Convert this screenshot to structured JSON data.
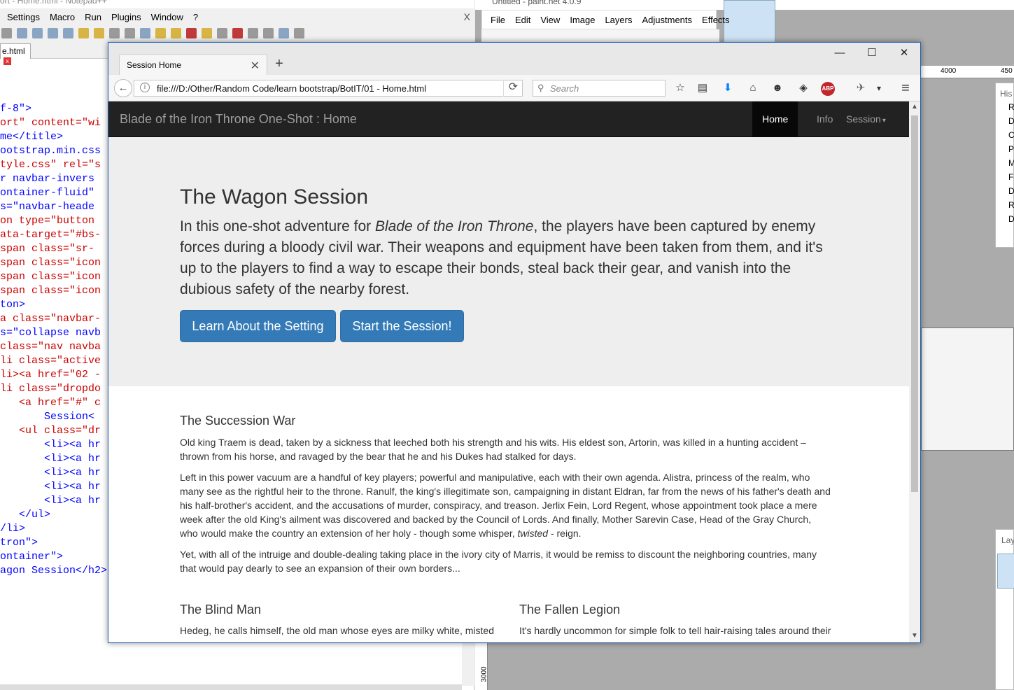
{
  "npp": {
    "title": "ort - Home.html - Notepad++",
    "menu": [
      "Settings",
      "Macro",
      "Run",
      "Plugins",
      "Window",
      "?"
    ],
    "close_glyph": "X",
    "tab_label": "e.html",
    "tab_close": "x",
    "code_lines": [
      "f-8\">",
      "ort\" content=\"wi",
      "me</title>",
      "ootstrap.min.css",
      "tyle.css\" rel=\"s",
      "",
      "",
      "r navbar-invers",
      "ontainer-fluid\"",
      "s=\"navbar-heade",
      "on type=\"button",
      "ata-target=\"#bs-",
      "span class=\"sr-",
      "span class=\"icon",
      "span class=\"icon",
      "span class=\"icon",
      "ton>",
      "a class=\"navbar-",
      "",
      "s=\"collapse navb",
      "class=\"nav navba",
      "li class=\"active",
      "li><a href=\"02 -",
      "li class=\"dropdo",
      "   <a href=\"#\" c",
      "       Session<",
      "   <ul class=\"dr",
      "       <li><a hr",
      "       <li><a hr",
      "       <li><a hr",
      "       <li><a hr",
      "       <li><a hr",
      "   </ul>",
      "/li>",
      "",
      "",
      "",
      "",
      "tron\">",
      "ontainer\">",
      "agon Session</h2>"
    ]
  },
  "pdn": {
    "title": "Untitled - paint.net 4.0.9",
    "menu": [
      "File",
      "Edit",
      "View",
      "Image",
      "Layers",
      "Adjustments",
      "Effects"
    ],
    "ruler_marks": [
      "4000",
      "450"
    ],
    "hist_labels": [
      "R",
      "D",
      "C",
      "P",
      "M",
      "F",
      "D",
      "R",
      "D"
    ],
    "history_title": "His",
    "layers_title": "Lay",
    "yruler_label": "3000"
  },
  "firefox": {
    "tab_title": "Session Home",
    "tab_close": "✕",
    "new_tab": "+",
    "minimize": "—",
    "maximize": "☐",
    "close": "✕",
    "back": "←",
    "info": "i",
    "url": "file:///D:/Other/Random Code/learn bootstrap/BotIT/01 - Home.html",
    "reload": "⟳",
    "search_placeholder": "Search",
    "search_icon": "⚲",
    "toolbar_icons": [
      "☆",
      "▤",
      "⬇",
      "⌂",
      "☻",
      "◈",
      "ABP",
      "✈",
      "▾",
      "≡"
    ],
    "scroll_up": "▲",
    "scroll_down": "▼"
  },
  "page": {
    "brand": "Blade of the Iron Throne One-Shot : Home",
    "nav": {
      "home": "Home",
      "info": "Info",
      "session": "Session",
      "caret": "▾"
    },
    "jumbotron": {
      "title": "The Wagon Session",
      "lead_pre": "In this one-shot adventure for ",
      "lead_em": "Blade of the Iron Throne",
      "lead_post": ", the players have been captured by enemy forces during a bloody civil war. Their weapons and equipment have been taken from them, and it's up to the players to find a way to escape their bonds, steal back their gear, and vanish into the dubious safety of the nearby forest.",
      "btn_setting": "Learn About the Setting",
      "btn_start": "Start the Session!"
    },
    "succession": {
      "title": "The Succession War",
      "p1": "Old king Traem is dead, taken by a sickness that leeched both his strength and his wits. His eldest son, Artorin, was killed in a hunting accident – thrown from his horse, and ravaged by the bear that he and his Dukes had stalked for days.",
      "p2_pre": "Left in this power vacuum are a handful of key players; powerful and manipulative, each with their own agenda. Alistra, princess of the realm, who many see as the rightful heir to the throne. Ranulf, the king's illegitimate son, campaigning in distant Eldran, far from the news of his father's death and his half-brother's accident, and the accusations of murder, conspiracy, and treason. Jerlix Fein, Lord Regent, whose appointment took place a mere week after the old King's ailment was discovered and backed by the Council of Lords. And finally, Mother Sarevin Case, Head of the Gray Church, who would make the country an extension of her holy - though some whisper, ",
      "p2_em": "twisted",
      "p2_post": " - reign.",
      "p3": "Yet, with all of the intruige and double-dealing taking place in the ivory city of Marris, it would be remiss to discount the neighboring countries, many that would pay dearly to see an expansion of their own borders..."
    },
    "blind_man": {
      "title": "The Blind Man",
      "text": "Hedeg, he calls himself, the old man whose eyes are milky white, misted"
    },
    "fallen_legion": {
      "title": "The Fallen Legion",
      "text": "It's hardly uncommon for simple folk to tell hair-raising tales around their"
    }
  },
  "colors": {
    "navbar_bg": "#222222",
    "jumbotron_bg": "#eeeeee",
    "btn_primary": "#337ab7",
    "window_border": "#1e5fb8"
  }
}
